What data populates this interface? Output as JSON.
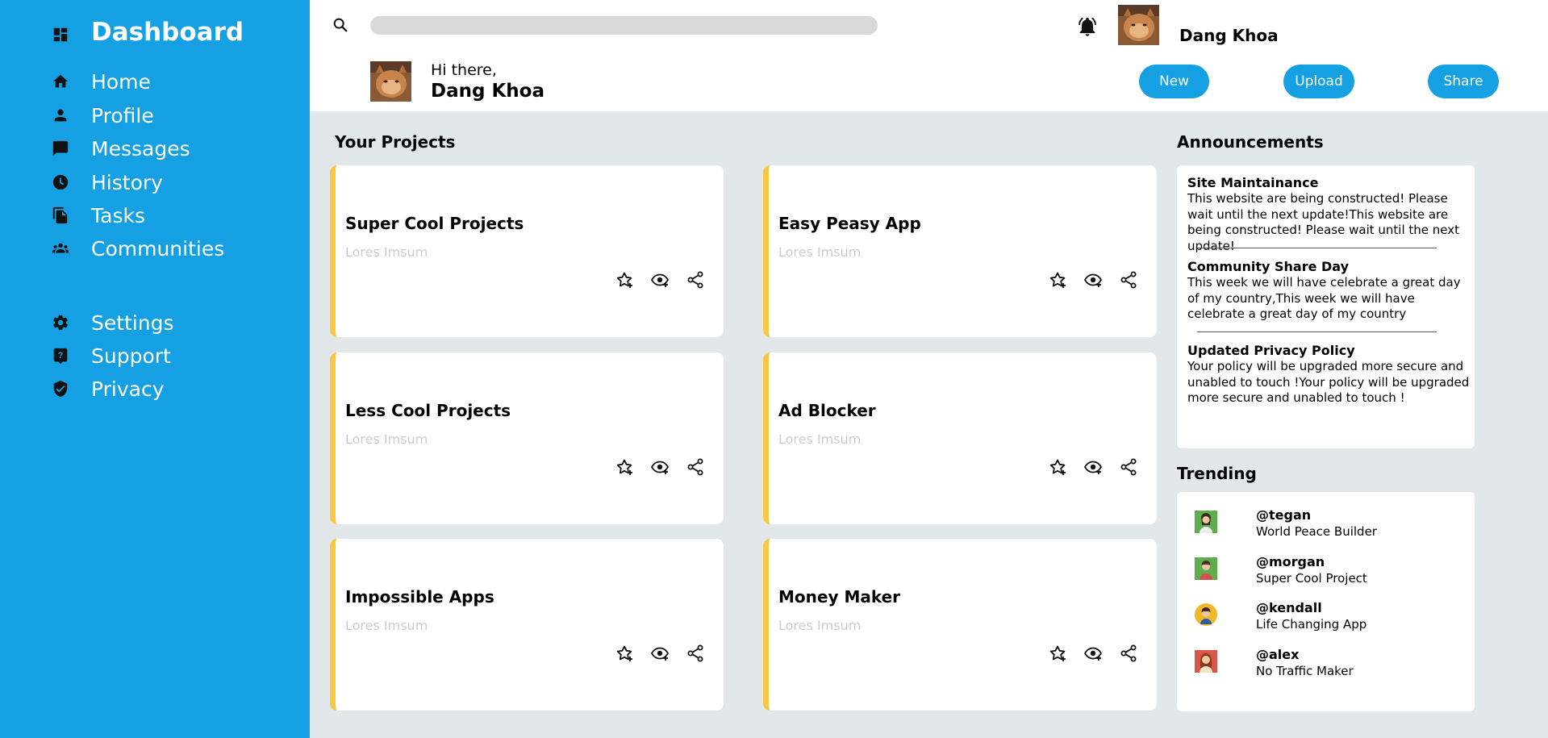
{
  "sidebar": {
    "brand": "Dashboard",
    "items": [
      {
        "label": "Home",
        "icon": "home-icon"
      },
      {
        "label": "Profile",
        "icon": "person-icon"
      },
      {
        "label": "Messages",
        "icon": "chat-icon"
      },
      {
        "label": "History",
        "icon": "clock-icon"
      },
      {
        "label": "Tasks",
        "icon": "document-icon"
      },
      {
        "label": "Communities",
        "icon": "people-icon"
      }
    ],
    "secondary": [
      {
        "label": "Settings",
        "icon": "gear-icon"
      },
      {
        "label": "Support",
        "icon": "help-icon"
      },
      {
        "label": "Privacy",
        "icon": "shield-icon"
      }
    ]
  },
  "header": {
    "username": "Dang Khoa",
    "greeting": "Hi there,",
    "greeting_name": "Dang Khoa",
    "buttons": {
      "new": "New",
      "upload": "Upload",
      "share": "Share"
    }
  },
  "projects": {
    "title": "Your Projects",
    "cards": [
      {
        "title": "Super Cool Projects",
        "subtitle": "Lores Imsum"
      },
      {
        "title": "Easy Peasy App",
        "subtitle": "Lores Imsum"
      },
      {
        "title": "Less Cool Projects",
        "subtitle": "Lores Imsum"
      },
      {
        "title": "Ad Blocker",
        "subtitle": "Lores Imsum"
      },
      {
        "title": "Impossible Apps",
        "subtitle": "Lores Imsum"
      },
      {
        "title": "Money Maker",
        "subtitle": "Lores Imsum"
      }
    ]
  },
  "announcements": {
    "title": "Announcements",
    "items": [
      {
        "title": "Site Maintainance",
        "body": "This website are being constructed! Please wait until the next update!This website are being constructed! Please wait until the next update!"
      },
      {
        "title": "Community Share Day",
        "body": "This week we will have celebrate a great day of my country,This week we will have celebrate a great day of my country"
      },
      {
        "title": "Updated Privacy Policy",
        "body": "Your policy will be upgraded more secure and unabled to touch !Your policy will be upgraded more secure and unabled to touch !"
      }
    ]
  },
  "trending": {
    "title": "Trending",
    "items": [
      {
        "handle": "@tegan",
        "desc": "World Peace Builder"
      },
      {
        "handle": "@morgan",
        "desc": "Super Cool Project"
      },
      {
        "handle": "@kendall",
        "desc": "Life Changing App"
      },
      {
        "handle": "@alex",
        "desc": "No Traffic Maker"
      }
    ]
  },
  "colors": {
    "primary": "#14a0e3",
    "accent": "#f7c843",
    "background": "#e2e8ea"
  }
}
